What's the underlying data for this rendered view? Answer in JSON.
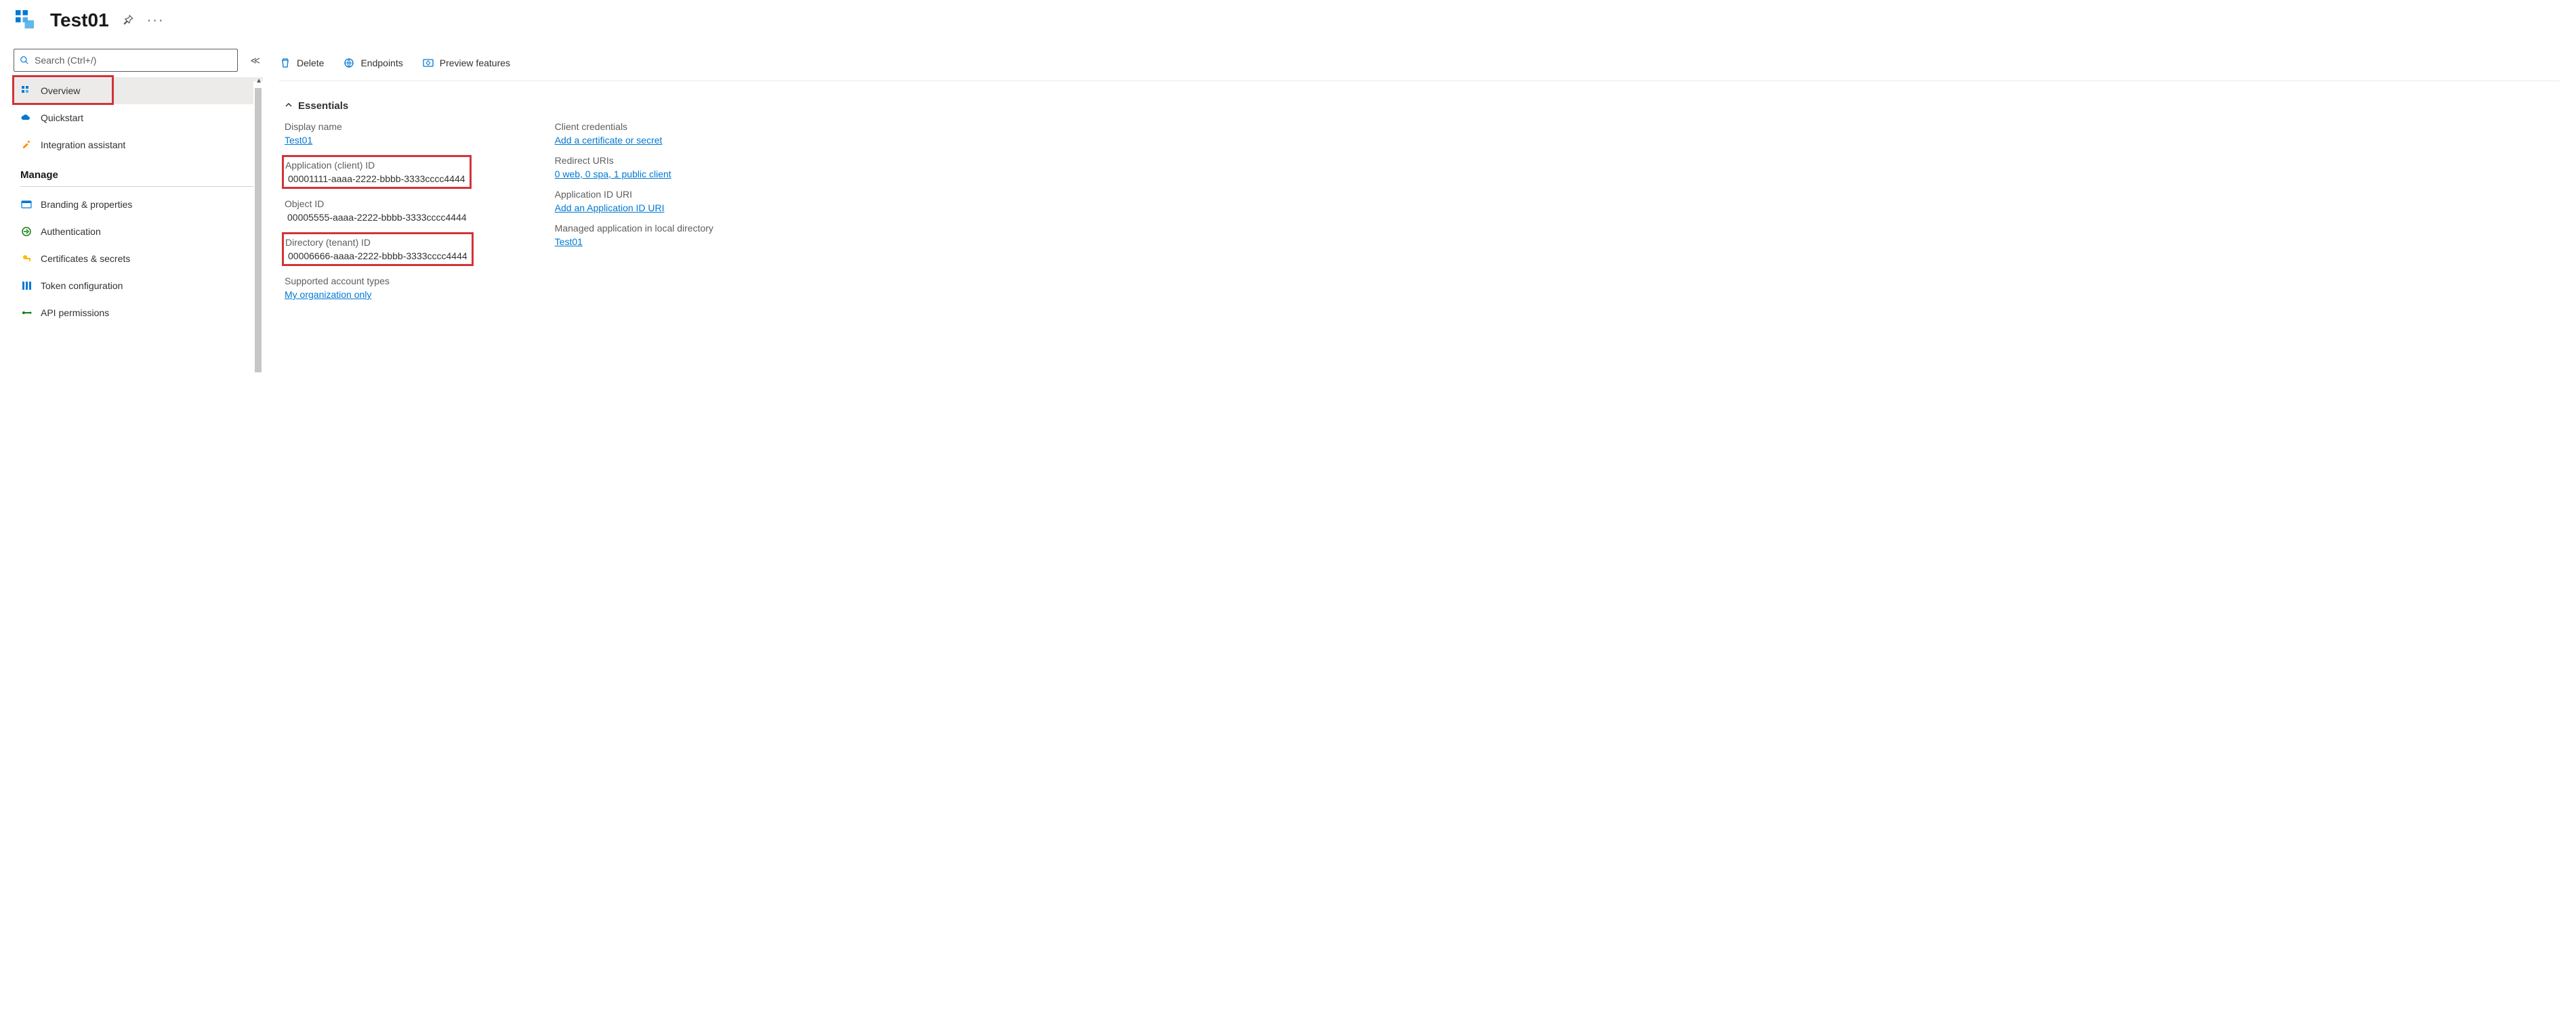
{
  "header": {
    "title": "Test01"
  },
  "sidebar": {
    "search_placeholder": "Search (Ctrl+/)",
    "items_top": [
      {
        "label": "Overview",
        "icon": "overview"
      },
      {
        "label": "Quickstart",
        "icon": "cloud"
      },
      {
        "label": "Integration assistant",
        "icon": "rocket"
      }
    ],
    "manage_label": "Manage",
    "items_manage": [
      {
        "label": "Branding & properties",
        "icon": "branding"
      },
      {
        "label": "Authentication",
        "icon": "auth"
      },
      {
        "label": "Certificates & secrets",
        "icon": "key"
      },
      {
        "label": "Token configuration",
        "icon": "token"
      },
      {
        "label": "API permissions",
        "icon": "api"
      }
    ]
  },
  "toolbar": {
    "delete": "Delete",
    "endpoints": "Endpoints",
    "preview": "Preview features"
  },
  "essentials": {
    "header": "Essentials",
    "left": {
      "display_name_label": "Display name",
      "display_name_value": "Test01",
      "app_id_label": "Application (client) ID",
      "app_id_value": "00001111-aaaa-2222-bbbb-3333cccc4444",
      "object_id_label": "Object ID",
      "object_id_value": "00005555-aaaa-2222-bbbb-3333cccc4444",
      "tenant_id_label": "Directory (tenant) ID",
      "tenant_id_value": "00006666-aaaa-2222-bbbb-3333cccc4444",
      "account_types_label": "Supported account types",
      "account_types_value": "My organization only"
    },
    "right": {
      "client_creds_label": "Client credentials",
      "client_creds_value": "Add a certificate or secret",
      "redirect_label": "Redirect URIs",
      "redirect_value": "0 web, 0 spa, 1 public client",
      "app_id_uri_label": "Application ID URI",
      "app_id_uri_value": "Add an Application ID URI",
      "managed_app_label": "Managed application in local directory",
      "managed_app_value": "Test01"
    }
  }
}
